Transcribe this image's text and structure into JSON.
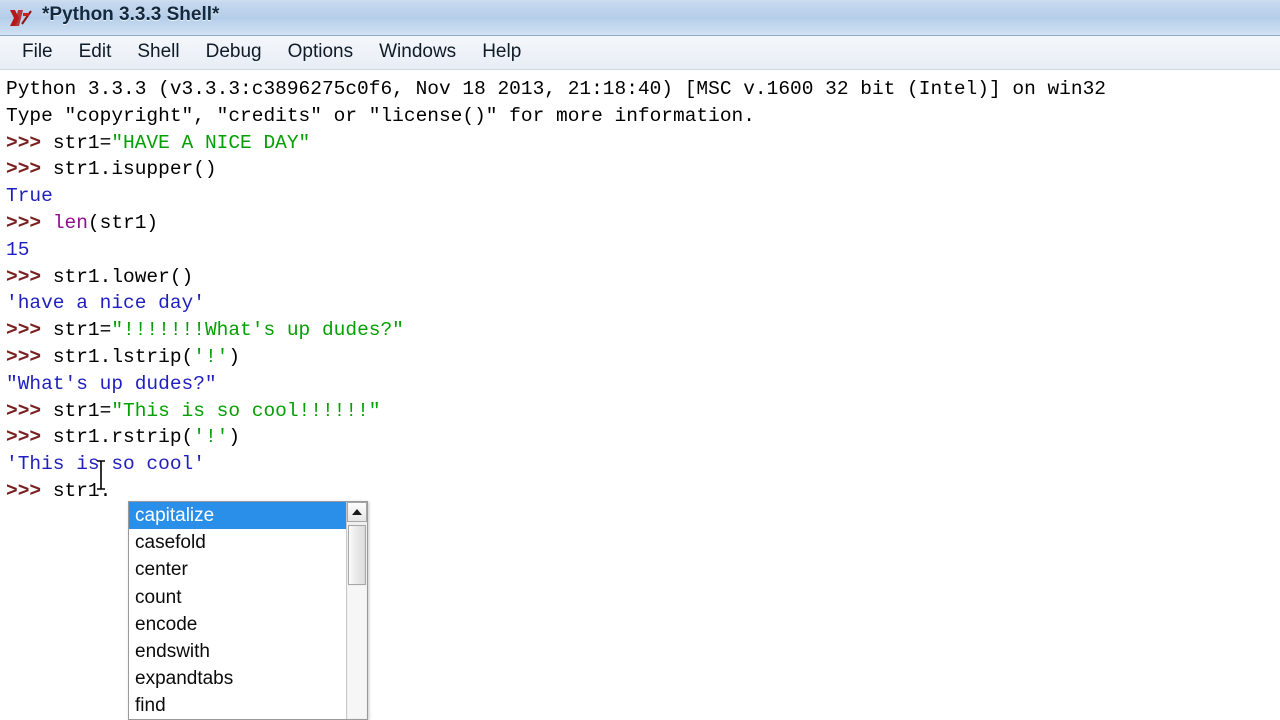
{
  "window": {
    "title": "*Python 3.3.3 Shell*",
    "icon": "python-idle-icon"
  },
  "menubar": {
    "items": [
      {
        "label": "File"
      },
      {
        "label": "Edit"
      },
      {
        "label": "Shell"
      },
      {
        "label": "Debug"
      },
      {
        "label": "Options"
      },
      {
        "label": "Windows"
      },
      {
        "label": "Help"
      }
    ]
  },
  "shell": {
    "lines": [
      {
        "id": "banner-version",
        "segments": [
          {
            "kind": "plain",
            "text": "Python 3.3.3 (v3.3.3:c3896275c0f6, Nov 18 2013, 21:18:40) [MSC v.1600 32 bit (Intel)] on win32"
          }
        ]
      },
      {
        "id": "banner-help",
        "segments": [
          {
            "kind": "plain",
            "text": "Type \"copyright\", \"credits\" or \"license()\" for more information."
          }
        ]
      },
      {
        "id": "input-assign-have-a-nice-day",
        "segments": [
          {
            "kind": "prompt",
            "text": ">>> "
          },
          {
            "kind": "plain",
            "text": "str1="
          },
          {
            "kind": "string",
            "text": "\"HAVE A NICE DAY\""
          }
        ]
      },
      {
        "id": "input-isupper",
        "segments": [
          {
            "kind": "prompt",
            "text": ">>> "
          },
          {
            "kind": "plain",
            "text": "str1.isupper()"
          }
        ]
      },
      {
        "id": "output-true",
        "segments": [
          {
            "kind": "output",
            "text": "True"
          }
        ]
      },
      {
        "id": "input-len",
        "segments": [
          {
            "kind": "prompt",
            "text": ">>> "
          },
          {
            "kind": "builtin",
            "text": "len"
          },
          {
            "kind": "plain",
            "text": "(str1)"
          }
        ]
      },
      {
        "id": "output-15",
        "segments": [
          {
            "kind": "output",
            "text": "15"
          }
        ]
      },
      {
        "id": "input-lower",
        "segments": [
          {
            "kind": "prompt",
            "text": ">>> "
          },
          {
            "kind": "plain",
            "text": "str1.lower()"
          }
        ]
      },
      {
        "id": "output-have-a-nice-day",
        "segments": [
          {
            "kind": "output",
            "text": "'have a nice day'"
          }
        ]
      },
      {
        "id": "input-assign-whats-up-dudes",
        "segments": [
          {
            "kind": "prompt",
            "text": ">>> "
          },
          {
            "kind": "plain",
            "text": "str1="
          },
          {
            "kind": "string",
            "text": "\"!!!!!!!What's up dudes?\""
          }
        ]
      },
      {
        "id": "input-lstrip",
        "segments": [
          {
            "kind": "prompt",
            "text": ">>> "
          },
          {
            "kind": "plain",
            "text": "str1.lstrip("
          },
          {
            "kind": "string",
            "text": "'!'"
          },
          {
            "kind": "plain",
            "text": ")"
          }
        ]
      },
      {
        "id": "output-whats-up-dudes",
        "segments": [
          {
            "kind": "output",
            "text": "\"What's up dudes?\""
          }
        ]
      },
      {
        "id": "input-assign-this-is-so-cool",
        "segments": [
          {
            "kind": "prompt",
            "text": ">>> "
          },
          {
            "kind": "plain",
            "text": "str1="
          },
          {
            "kind": "string",
            "text": "\"This is so cool!!!!!!\""
          }
        ]
      },
      {
        "id": "input-rstrip",
        "segments": [
          {
            "kind": "prompt",
            "text": ">>> "
          },
          {
            "kind": "plain",
            "text": "str1.rstrip("
          },
          {
            "kind": "string",
            "text": "'!'"
          },
          {
            "kind": "plain",
            "text": ")"
          }
        ]
      },
      {
        "id": "output-this-is-so-cool",
        "segments": [
          {
            "kind": "output",
            "text": "'This is so cool'"
          }
        ]
      },
      {
        "id": "input-current",
        "segments": [
          {
            "kind": "prompt",
            "text": ">>> "
          },
          {
            "kind": "plain",
            "text": "str1."
          }
        ]
      }
    ]
  },
  "autocomplete": {
    "selected_index": 0,
    "items": [
      {
        "label": "capitalize"
      },
      {
        "label": "casefold"
      },
      {
        "label": "center"
      },
      {
        "label": "count"
      },
      {
        "label": "encode"
      },
      {
        "label": "endswith"
      },
      {
        "label": "expandtabs"
      },
      {
        "label": "find"
      }
    ],
    "scrollbar": {
      "up_arrow_icon": "caret-up-icon"
    }
  },
  "colors": {
    "prompt": "#7a2020",
    "string": "#03a003",
    "output": "#1f1fbf",
    "builtin": "#8f0f8f",
    "plain": "#000000",
    "selection": "#2a8fe8",
    "titlebar": "#b9d0ea"
  }
}
